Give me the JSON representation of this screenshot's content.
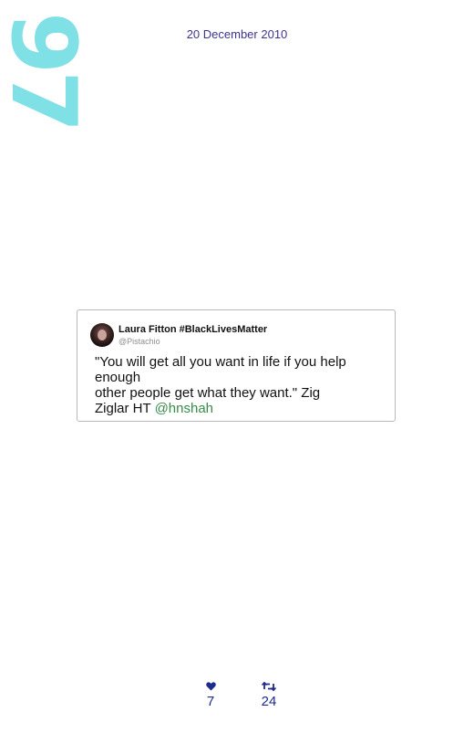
{
  "page": {
    "number": "97",
    "date": "20 December 2010"
  },
  "tweet": {
    "author_name": "Laura Fitton #BlackLivesMatter",
    "author_handle": "@Pistachio",
    "text_line1": "\"You will get all you want in life if you help",
    "text_line2": "enough",
    "text_line3": "other people get what they want.\" Zig",
    "text_line4_prefix": "Ziglar HT ",
    "mention": "@hnshah",
    "mention_color": "#3a8a4a"
  },
  "stats": {
    "likes_icon": "heart-icon",
    "likes": "7",
    "retweets_icon": "retweet-icon",
    "retweets": "24",
    "color": "#1e2a8c"
  },
  "colors": {
    "page_number": "#7fe0e5",
    "date": "#3d3490"
  }
}
